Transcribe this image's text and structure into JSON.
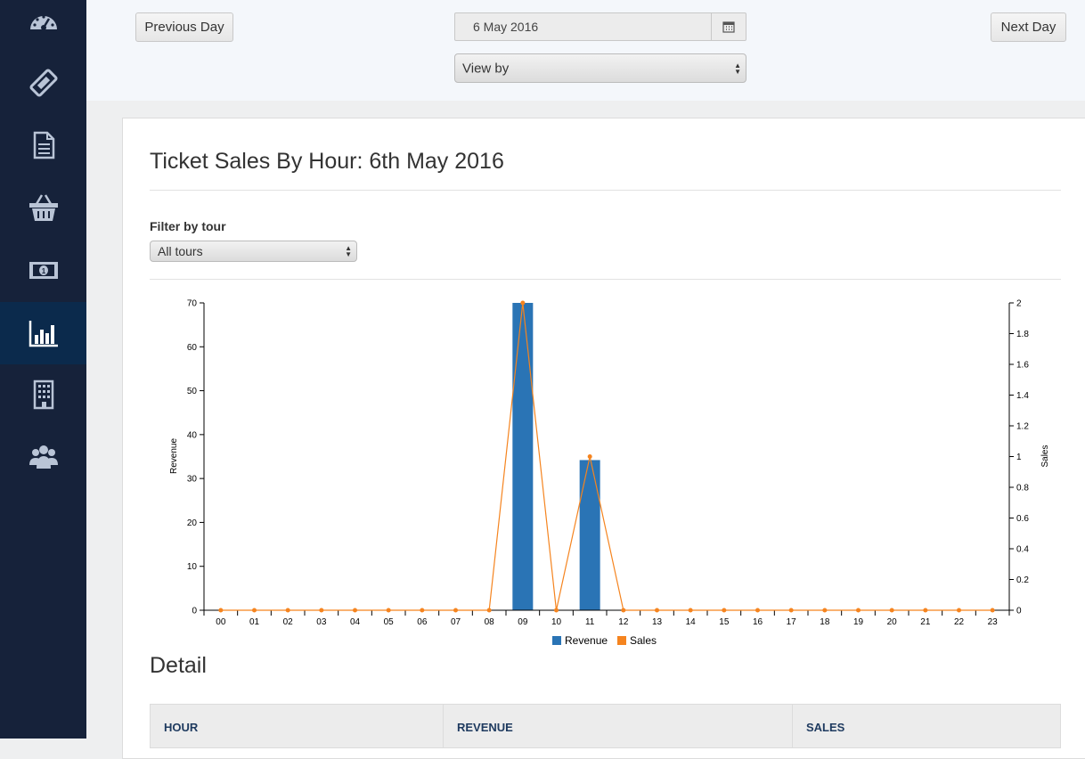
{
  "sidebar": {
    "items": [
      {
        "icon": "dashboard-icon",
        "active": false
      },
      {
        "icon": "ticket-icon",
        "active": false
      },
      {
        "icon": "document-icon",
        "active": false
      },
      {
        "icon": "basket-icon",
        "active": false
      },
      {
        "icon": "money-icon",
        "active": false
      },
      {
        "icon": "bar-chart-icon",
        "active": true
      },
      {
        "icon": "building-icon",
        "active": false
      },
      {
        "icon": "users-icon",
        "active": false
      }
    ]
  },
  "toolbar": {
    "prev_label": "Previous Day",
    "next_label": "Next Day",
    "date_value": "6 May 2016",
    "view_by_label": "View by"
  },
  "main": {
    "title": "Ticket Sales By Hour: 6th May 2016",
    "filter_label": "Filter by tour",
    "filter_value": "All tours",
    "detail_title": "Detail"
  },
  "table": {
    "columns": [
      "HOUR",
      "REVENUE",
      "SALES"
    ]
  },
  "colors": {
    "revenue": "#2a74b5",
    "sales": "#f5841f",
    "sidebar_bg": "#16223a",
    "sidebar_active": "#0b2a4c",
    "icon": "#b9c4d6"
  },
  "chart_data": {
    "type": "bar",
    "categories": [
      "00",
      "01",
      "02",
      "03",
      "04",
      "05",
      "06",
      "07",
      "08",
      "09",
      "10",
      "11",
      "12",
      "13",
      "14",
      "15",
      "16",
      "17",
      "18",
      "19",
      "20",
      "21",
      "22",
      "23"
    ],
    "series": [
      {
        "name": "Revenue",
        "type": "bar",
        "axis": "left",
        "values": [
          0,
          0,
          0,
          0,
          0,
          0,
          0,
          0,
          0,
          70,
          0,
          34.2,
          0,
          0,
          0,
          0,
          0,
          0,
          0,
          0,
          0,
          0,
          0,
          0
        ]
      },
      {
        "name": "Sales",
        "type": "line",
        "axis": "right",
        "values": [
          0,
          0,
          0,
          0,
          0,
          0,
          0,
          0,
          0,
          2,
          0,
          1,
          0,
          0,
          0,
          0,
          0,
          0,
          0,
          0,
          0,
          0,
          0,
          0
        ]
      }
    ],
    "ylabel": "Revenue",
    "y2label": "Sales",
    "ylim": [
      0,
      70
    ],
    "y2lim": [
      0,
      2
    ],
    "yticks": [
      "0",
      "10",
      "20",
      "30",
      "40",
      "50",
      "60",
      "70"
    ],
    "y2ticks": [
      "0",
      "0.2",
      "0.4",
      "0.6",
      "0.8",
      "1",
      "1.2",
      "1.4",
      "1.6",
      "1.8",
      "2"
    ],
    "legend": [
      "Revenue",
      "Sales"
    ],
    "legend_position": "bottom"
  }
}
